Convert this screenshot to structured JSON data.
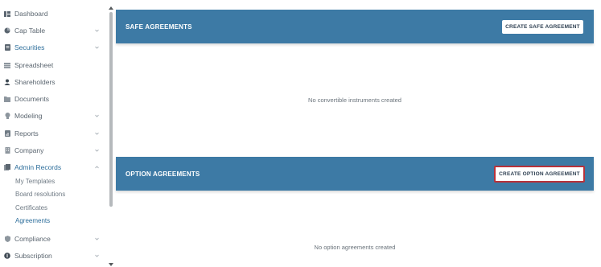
{
  "sidebar": {
    "items": [
      {
        "label": "Dashboard",
        "icon": "dashboard-icon",
        "chevron": false
      },
      {
        "label": "Cap Table",
        "icon": "pie-chart-icon",
        "chevron": true
      },
      {
        "label": "Securities",
        "icon": "document-icon",
        "chevron": true
      },
      {
        "label": "Spreadsheet",
        "icon": "spreadsheet-icon",
        "chevron": false
      },
      {
        "label": "Shareholders",
        "icon": "user-icon",
        "chevron": false
      },
      {
        "label": "Documents",
        "icon": "folder-icon",
        "chevron": false
      },
      {
        "label": "Modeling",
        "icon": "lightbulb-icon",
        "chevron": true
      },
      {
        "label": "Reports",
        "icon": "report-icon",
        "chevron": true
      },
      {
        "label": "Company",
        "icon": "building-icon",
        "chevron": true
      },
      {
        "label": "Admin Records",
        "icon": "records-icon",
        "chevron": true
      },
      {
        "label": "Compliance",
        "icon": "shield-icon",
        "chevron": true
      },
      {
        "label": "Subscription",
        "icon": "subscription-icon",
        "chevron": true
      }
    ],
    "admin_sub": [
      "My Templates",
      "Board resolutions",
      "Certificates",
      "Agreements"
    ]
  },
  "safe": {
    "title": "SAFE AGREEMENTS",
    "button": "CREATE SAFE AGREEMENT",
    "empty": "No convertible instruments created"
  },
  "option": {
    "title": "OPTION AGREEMENTS",
    "button": "CREATE OPTION AGREEMENT",
    "empty": "No option agreements created"
  },
  "colors": {
    "header": "#3d7aa5",
    "active": "#2d6e9b",
    "highlight": "#b8323a"
  }
}
